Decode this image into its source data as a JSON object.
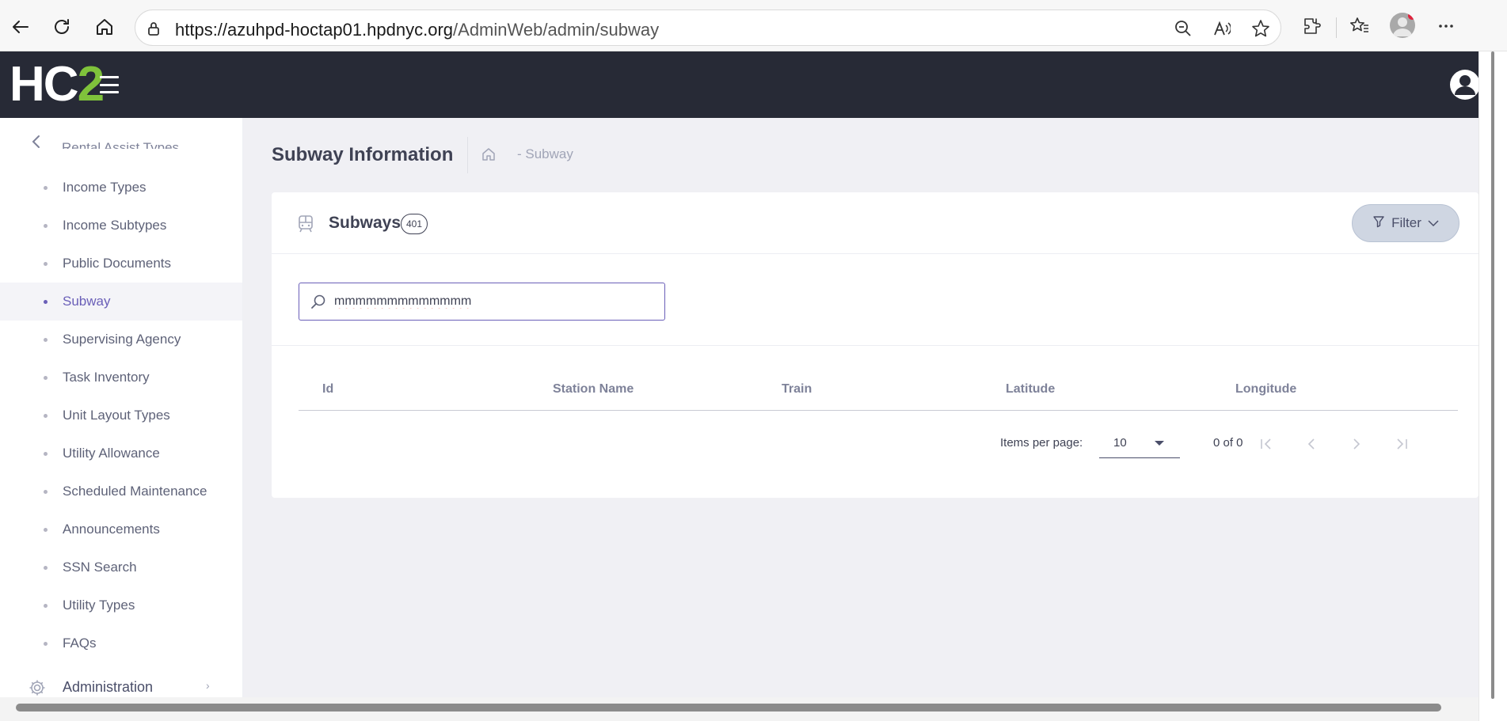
{
  "browser": {
    "url_host": "https://azuhpd-hoctap01.hpdnyc.org",
    "url_path": "/AdminWeb/admin/subway"
  },
  "app": {
    "logo_prefix": "HC",
    "logo_suffix": "2",
    "brand_color": "#7fc23b",
    "header_color": "#272a36"
  },
  "sidebar": {
    "partial_item": "Rental Assist Types",
    "items": [
      {
        "label": "Income Types"
      },
      {
        "label": "Income Subtypes"
      },
      {
        "label": "Public Documents"
      },
      {
        "label": "Subway"
      },
      {
        "label": "Supervising Agency"
      },
      {
        "label": "Task Inventory"
      },
      {
        "label": "Unit Layout Types"
      },
      {
        "label": "Utility Allowance"
      },
      {
        "label": "Scheduled Maintenance"
      },
      {
        "label": "Announcements"
      },
      {
        "label": "SSN Search"
      },
      {
        "label": "Utility Types"
      },
      {
        "label": "FAQs"
      }
    ],
    "active_item": "Subway",
    "admin_label": "Administration"
  },
  "page": {
    "title": "Subway Information",
    "breadcrumb": "- Subway"
  },
  "card": {
    "title": "Subways",
    "count": "401",
    "filter_label": "Filter"
  },
  "search": {
    "value": "mmmmmmmmmmmmm",
    "icon": "search-icon"
  },
  "table": {
    "columns": [
      "Id",
      "Station Name",
      "Train",
      "Latitude",
      "Longitude"
    ]
  },
  "paginator": {
    "items_per_page_label": "Items per page:",
    "page_size": "10",
    "range_label": "0 of 0"
  },
  "colors": {
    "accent": "#6a5fb8",
    "filter_bg": "#cfd6e2"
  }
}
